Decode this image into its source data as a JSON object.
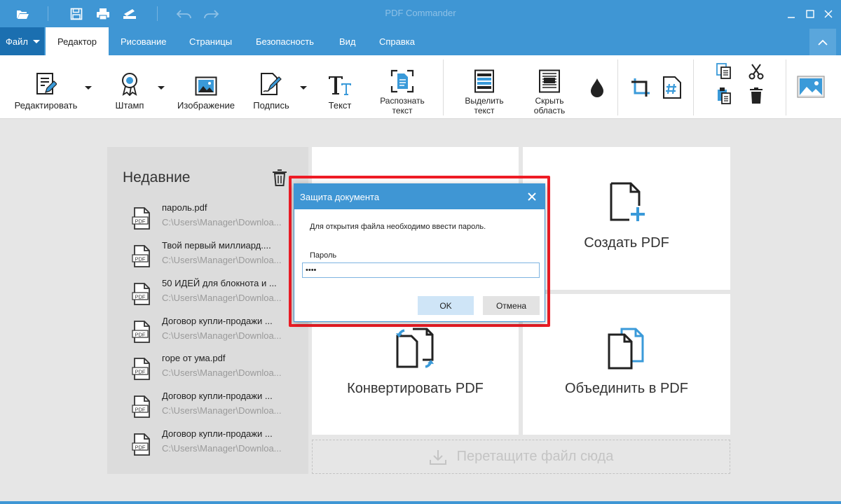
{
  "titlebar": {
    "title": "PDF Commander",
    "icons": [
      "open-folder-icon",
      "save-icon",
      "print-icon",
      "scan-icon",
      "undo-icon",
      "redo-icon"
    ],
    "window_controls": [
      "minimize-icon",
      "maximize-icon",
      "close-icon"
    ]
  },
  "menu": {
    "file": "Файл",
    "tabs": [
      "Редактор",
      "Рисование",
      "Страницы",
      "Безопасность",
      "Вид",
      "Справка"
    ],
    "active_tab": "Редактор"
  },
  "ribbon": {
    "edit": "Редактировать",
    "stamp": "Штамп",
    "image": "Изображение",
    "sign": "Подпись",
    "text": "Текст",
    "ocr_1": "Распознать",
    "ocr_2": "текст",
    "select_1": "Выделить",
    "select_2": "текст",
    "hide_1": "Скрыть",
    "hide_2": "область",
    "small_icons": [
      "ink-drop-icon",
      "crop-icon",
      "page-number-icon",
      "copy-icon",
      "cut-icon",
      "paste-icon",
      "delete-icon",
      "insert-image-icon"
    ]
  },
  "recent": {
    "title": "Недавние",
    "items": [
      {
        "name": "пароль.pdf",
        "path": "C:\\Users\\Manager\\Downloa..."
      },
      {
        "name": "Твой первый миллиард....",
        "path": "C:\\Users\\Manager\\Downloa..."
      },
      {
        "name": "50 ИДЕЙ  для блокнота и ...",
        "path": "C:\\Users\\Manager\\Downloa..."
      },
      {
        "name": "Договор купли-продажи ...",
        "path": "C:\\Users\\Manager\\Downloa..."
      },
      {
        "name": "горе от ума.pdf",
        "path": "C:\\Users\\Manager\\Downloa..."
      },
      {
        "name": "Договор купли-продажи ...",
        "path": "C:\\Users\\Manager\\Downloa..."
      },
      {
        "name": "Договор купли-продажи ...",
        "path": "C:\\Users\\Manager\\Downloa..."
      }
    ],
    "file_icon_text": "PDF"
  },
  "cards": {
    "create": "Создать PDF",
    "convert": "Конвертировать PDF",
    "merge": "Объединить в PDF"
  },
  "drop": {
    "label": "Перетащите файл сюда"
  },
  "dialog": {
    "title": "Защита документа",
    "message": "Для открытия файла необходимо ввести пароль.",
    "password_label": "Пароль",
    "password_value": "••••",
    "ok": "OK",
    "cancel": "Отмена"
  },
  "colors": {
    "accent": "#3f96d4",
    "file_menu": "#1b6fb0",
    "highlight": "#ee1c25",
    "icon_blue": "#3a9ad9"
  }
}
